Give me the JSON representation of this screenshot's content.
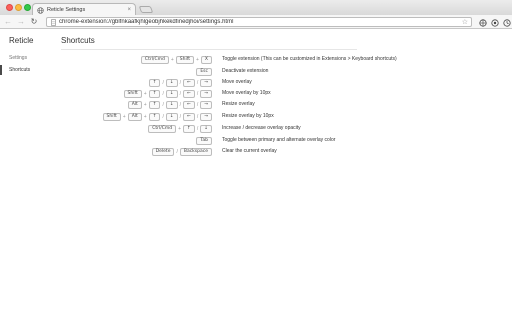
{
  "browser": {
    "tab_title": "Reticle Settings",
    "tab_close": "×",
    "url": "chrome-extension://gblfnkaafkjhlgeobjhkekdfinedjhoi/settings.html",
    "nav": {
      "back": "←",
      "forward": "→",
      "reload": "↻",
      "star": "☆"
    }
  },
  "sidebar": {
    "title": "Reticle",
    "items": [
      {
        "label": "Settings"
      },
      {
        "label": "Shortcuts"
      }
    ]
  },
  "main": {
    "title": "Shortcuts",
    "shortcuts": [
      {
        "keys": [
          "Ctrl/Cmd",
          "+",
          "Shift",
          "+",
          "X"
        ],
        "description": "Toggle extension (This can be customized in Extensions > Keyboard shortcuts)"
      },
      {
        "keys": [
          "Esc"
        ],
        "description": "Deactivate extension"
      },
      {
        "keys": [
          "↑",
          "/",
          "↓",
          "/",
          "←",
          "/",
          "→"
        ],
        "description": "Move overlay"
      },
      {
        "keys": [
          "Shift",
          "+",
          "↑",
          "/",
          "↓",
          "/",
          "←",
          "/",
          "→"
        ],
        "description": "Move overlay by 10px"
      },
      {
        "keys": [
          "Alt",
          "+",
          "↑",
          "/",
          "↓",
          "/",
          "←",
          "/",
          "→"
        ],
        "description": "Resize overlay"
      },
      {
        "keys": [
          "Shift",
          "+",
          "Alt",
          "+",
          "↑",
          "/",
          "↓",
          "/",
          "←",
          "/",
          "→"
        ],
        "description": "Resize overlay by 10px"
      },
      {
        "keys": [
          "Ctrl/Cmd",
          "+",
          "↑",
          "/",
          "↓"
        ],
        "description": "Increase / decrease overlay opacity"
      },
      {
        "keys": [
          "Tab"
        ],
        "description": "Toggle between primary and alternate overlay color"
      },
      {
        "keys": [
          "Delete",
          "/",
          "Backspace"
        ],
        "description": "Clear the current overlay"
      }
    ]
  },
  "colors": {
    "accent": "#4a4a4a",
    "text": "#333333",
    "muted": "#777777"
  },
  "icons": [
    "globe-icon",
    "back-icon",
    "forward-icon",
    "reload-icon",
    "star-icon",
    "extension-icon",
    "menu-icon"
  ]
}
